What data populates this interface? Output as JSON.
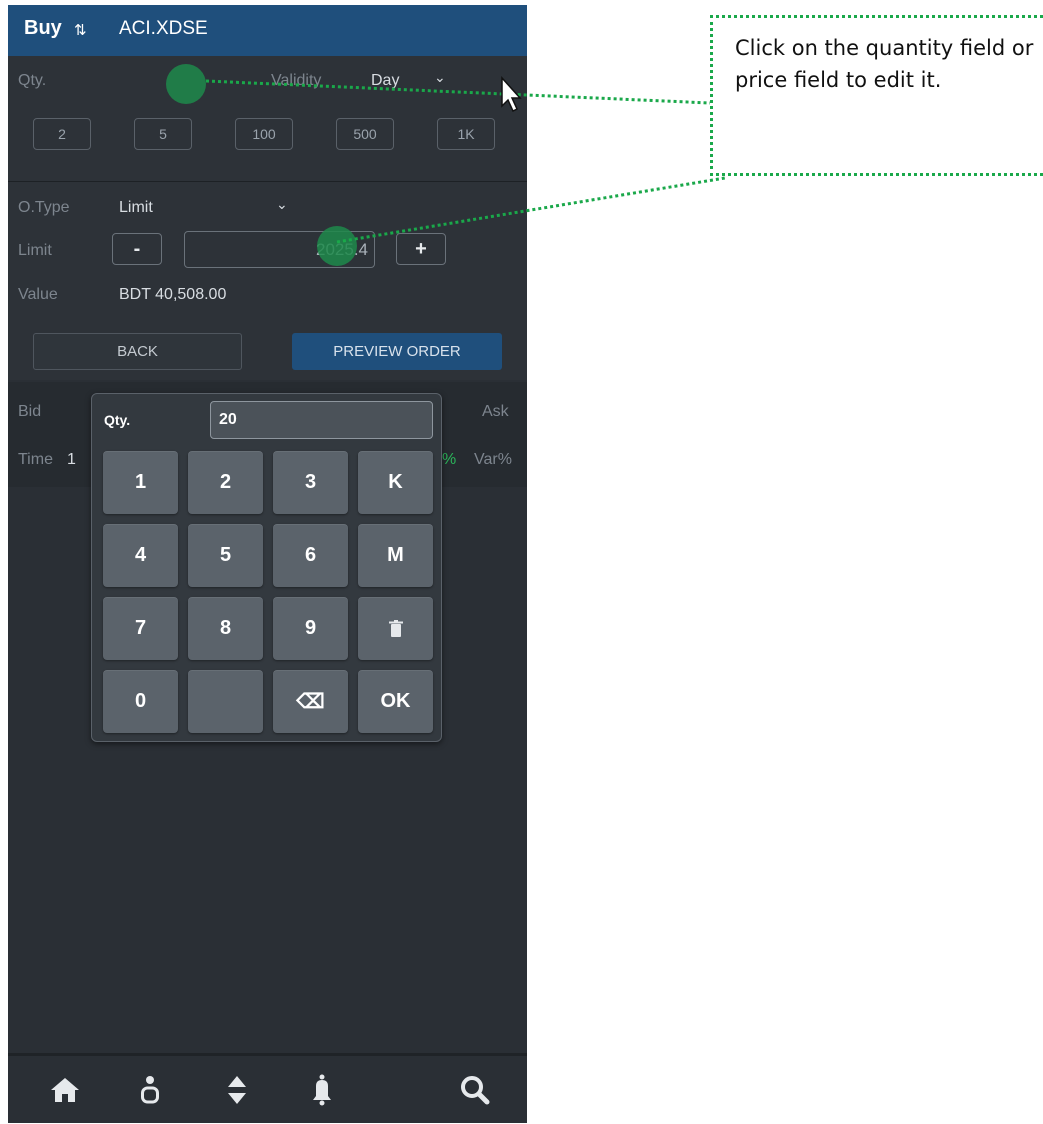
{
  "header": {
    "side": "Buy",
    "swap_icon": "⇅",
    "symbol": "ACI.XDSE"
  },
  "order": {
    "qty_label": "Qty.",
    "validity_label": "Validity",
    "validity_value": "Day",
    "quick_qty": [
      "2",
      "5",
      "100",
      "500",
      "1K"
    ],
    "otype_label": "O.Type",
    "otype_value": "Limit",
    "limit_label": "Limit",
    "minus": "-",
    "plus": "+",
    "limit_value": "2025.4",
    "value_label": "Value",
    "value_amount": "BDT 40,508.00",
    "back_label": "BACK",
    "preview_label": "PREVIEW ORDER"
  },
  "depth": {
    "bid_label": "Bid",
    "ask_label": "Ask",
    "time_label": "Time",
    "time_value": "1",
    "pct": "%",
    "var_label": "Var%"
  },
  "keypad": {
    "label": "Qty.",
    "value": "20",
    "keys": [
      "1",
      "2",
      "3",
      "K",
      "4",
      "5",
      "6",
      "M",
      "7",
      "8",
      "9",
      "",
      "0",
      "",
      "⌫",
      "OK"
    ]
  },
  "tip": {
    "text": "Click on the quantity field or price field to edit it."
  },
  "tabs": [
    "home-icon",
    "person-icon",
    "swap-icon",
    "bell-icon",
    "search-icon"
  ],
  "colors": {
    "header": "#1f4f7c",
    "panel": "#2d3238",
    "accent_green": "#1aa84a",
    "key": "#5b636b"
  }
}
